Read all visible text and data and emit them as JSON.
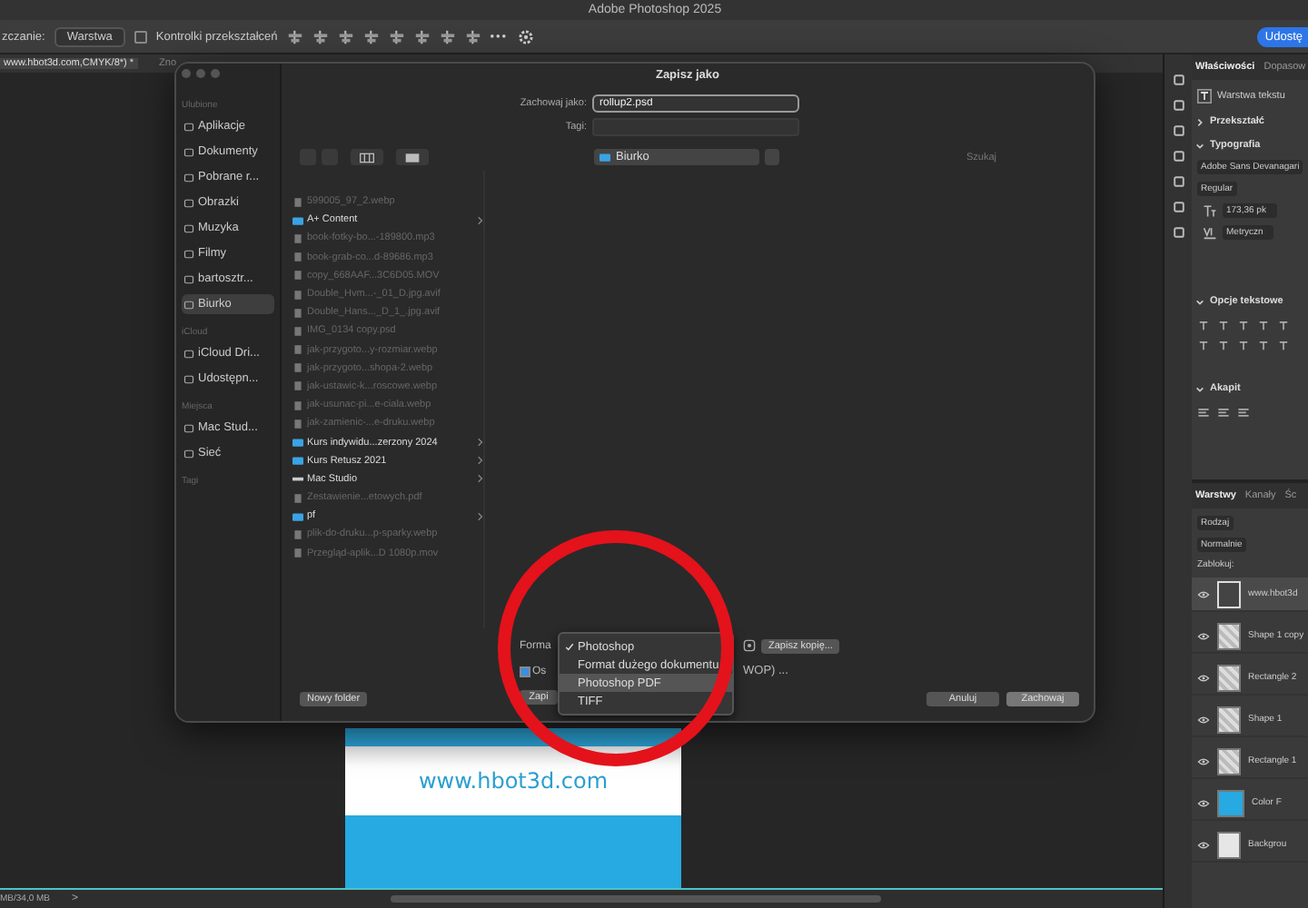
{
  "app_title": "Adobe Photoshop 2025",
  "options_bar": {
    "label": "zczanie:",
    "select": "Warstwa",
    "checkbox": {
      "label": "Kontrolki przekształceń",
      "checked": false
    },
    "more": "•••",
    "share_button": "Udostę"
  },
  "doc_tabs": [
    {
      "label": "www.hbot3d.com,CMYK/8*) *",
      "selected": true
    },
    {
      "label": "Zno",
      "selected": false
    }
  ],
  "canvas": {
    "text": "www.hbot3d.com"
  },
  "status_bar": {
    "text": "MB/34,0 MB",
    "arrow": ">"
  },
  "properties": {
    "tabs": [
      {
        "label": "Właściwości",
        "selected": true
      },
      {
        "label": "Dopasow",
        "selected": false
      }
    ],
    "layer_type": "Warstwa tekstu",
    "transform": {
      "title": "Przekształć",
      "expanded": false
    },
    "typography": {
      "title": "Typografia",
      "expanded": true,
      "font": "Adobe Sans Devanagari",
      "style": "Regular",
      "size": "173,36 pk",
      "kerning": "Metryczn"
    },
    "text_options": {
      "title": "Opcje tekstowe",
      "expanded": true
    },
    "paragraph": {
      "title": "Akapit",
      "expanded": true
    }
  },
  "layers": {
    "tabs": [
      {
        "label": "Warstwy",
        "selected": true
      },
      {
        "label": "Kanały",
        "selected": false
      },
      {
        "label": "Śc",
        "selected": false
      }
    ],
    "filter": "Rodzaj",
    "blend": "Normalnie",
    "lock_label": "Zablokuj:",
    "rows": [
      {
        "name": "www.hbot3d",
        "kind": "text",
        "selected": true
      },
      {
        "name": "Shape 1 copy",
        "kind": "shape",
        "selected": false
      },
      {
        "name": "Rectangle 2",
        "kind": "shape",
        "selected": false
      },
      {
        "name": "Shape 1",
        "kind": "shape",
        "selected": false
      },
      {
        "name": "Rectangle 1",
        "kind": "shape",
        "selected": false
      },
      {
        "name": "Color F",
        "kind": "fill",
        "selected": false
      },
      {
        "name": "Backgrou",
        "kind": "plain",
        "selected": false
      }
    ]
  },
  "dialog": {
    "title": "Zapisz jako",
    "save_as_label": "Zachowaj jako:",
    "save_as_value": "rollup2.psd",
    "tags_label": "Tagi:",
    "location": "Biurko",
    "search_placeholder": "Szukaj",
    "sidebar": [
      {
        "title": "Ulubione",
        "items": [
          {
            "label": "Aplikacje",
            "selected": false
          },
          {
            "label": "Dokumenty",
            "selected": false
          },
          {
            "label": "Pobrane r...",
            "selected": false
          },
          {
            "label": "Obrazki",
            "selected": false
          },
          {
            "label": "Muzyka",
            "selected": false
          },
          {
            "label": "Filmy",
            "selected": false
          },
          {
            "label": "bartosztr...",
            "selected": false
          },
          {
            "label": "Biurko",
            "selected": true
          }
        ]
      },
      {
        "title": "iCloud",
        "items": [
          {
            "label": "iCloud Dri...",
            "selected": false
          },
          {
            "label": "Udostępn...",
            "selected": false
          }
        ]
      },
      {
        "title": "Miejsca",
        "items": [
          {
            "label": "Mac Stud...",
            "selected": false
          },
          {
            "label": "Sieć",
            "selected": false
          }
        ]
      },
      {
        "title": "Tagi"
      }
    ],
    "files": [
      {
        "name": "599005_97_2.webp",
        "kind": "file",
        "disabled": true
      },
      {
        "name": "A+ Content",
        "kind": "folder",
        "disabled": false
      },
      {
        "name": "book-fotky-bo...-189800.mp3",
        "kind": "file",
        "disabled": true
      },
      {
        "name": "book-grab-co...d-89686.mp3",
        "kind": "file",
        "disabled": true
      },
      {
        "name": "copy_668AAF...3C6D05.MOV",
        "kind": "file",
        "disabled": true
      },
      {
        "name": "Double_Hvm...-_01_D.jpg.avif",
        "kind": "file",
        "disabled": true
      },
      {
        "name": "Double_Hans..._D_1_.jpg.avif",
        "kind": "file",
        "disabled": true
      },
      {
        "name": "IMG_0134 copy.psd",
        "kind": "file",
        "disabled": true
      },
      {
        "name": "jak-przygoto...y-rozmiar.webp",
        "kind": "file",
        "disabled": true
      },
      {
        "name": "jak-przygoto...shopa-2.webp",
        "kind": "file",
        "disabled": true
      },
      {
        "name": "jak-ustawic-k...roscowe.webp",
        "kind": "file",
        "disabled": true
      },
      {
        "name": "jak-usunac-pi...e-ciala.webp",
        "kind": "file",
        "disabled": true
      },
      {
        "name": "jak-zamienic-...e-druku.webp",
        "kind": "file",
        "disabled": true
      },
      {
        "name": "Kurs indywidu...zerzony 2024",
        "kind": "folder",
        "disabled": false
      },
      {
        "name": "Kurs Retusz 2021",
        "kind": "folder",
        "disabled": false
      },
      {
        "name": "Mac Studio",
        "kind": "drive",
        "disabled": false
      },
      {
        "name": "Zestawienie...etowych.pdf",
        "kind": "file",
        "disabled": true
      },
      {
        "name": "pf",
        "kind": "folder",
        "disabled": false
      },
      {
        "name": "plik-do-druku...p-sparky.webp",
        "kind": "file",
        "disabled": true
      },
      {
        "name": "Przegląd-aplik...D 1080p.mov",
        "kind": "file",
        "disabled": true
      }
    ],
    "format_label": "Forma",
    "copy_button": "Zapisz kopię...",
    "option_checkbox": {
      "label": "Os",
      "checked": true
    },
    "option_tail": "WOP) ...",
    "partial_button": "Zapi",
    "format_menu": [
      {
        "label": "Photoshop",
        "selected": true,
        "highlighted": false
      },
      {
        "label": "Format dużego dokumentu",
        "selected": false,
        "highlighted": false
      },
      {
        "label": "Photoshop PDF",
        "selected": false,
        "highlighted": true
      },
      {
        "label": "TIFF",
        "selected": false,
        "highlighted": false
      }
    ],
    "new_folder_button": "Nowy folder",
    "cancel_button": "Anuluj",
    "save_button": "Zachowaj"
  }
}
